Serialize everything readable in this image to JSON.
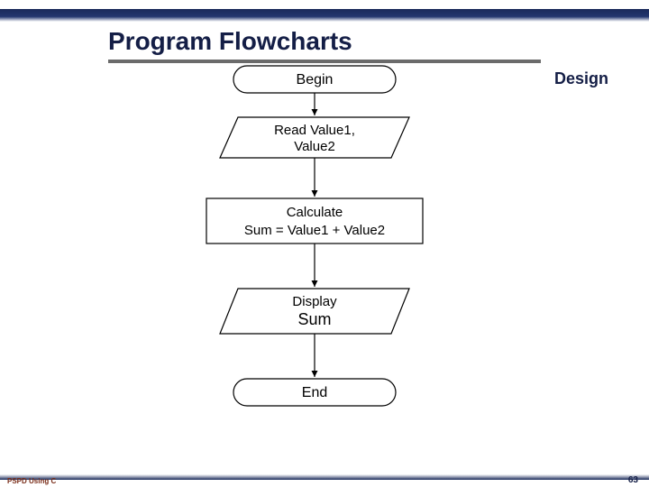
{
  "slide": {
    "title": "Program Flowcharts",
    "corner_label": "Design",
    "footer_left": "PSPD Using C",
    "page_number": "63"
  },
  "flow": {
    "begin": "Begin",
    "read_line1": "Read Value1,",
    "read_line2": "Value2",
    "calc_line1": "Calculate",
    "calc_line2": "Sum = Value1 + Value2",
    "display_line1": "Display",
    "display_line2": "Sum",
    "end": "End"
  },
  "chart_data": {
    "type": "diagram",
    "subtype": "flowchart",
    "title": "Program Flowcharts",
    "nodes": [
      {
        "id": "begin",
        "shape": "terminator",
        "label": "Begin"
      },
      {
        "id": "read",
        "shape": "io",
        "label": "Read Value1, Value2"
      },
      {
        "id": "calc",
        "shape": "process",
        "label": "Calculate Sum = Value1 + Value2"
      },
      {
        "id": "display",
        "shape": "io",
        "label": "Display Sum"
      },
      {
        "id": "end",
        "shape": "terminator",
        "label": "End"
      }
    ],
    "edges": [
      {
        "from": "begin",
        "to": "read"
      },
      {
        "from": "read",
        "to": "calc"
      },
      {
        "from": "calc",
        "to": "display"
      },
      {
        "from": "display",
        "to": "end"
      }
    ]
  }
}
